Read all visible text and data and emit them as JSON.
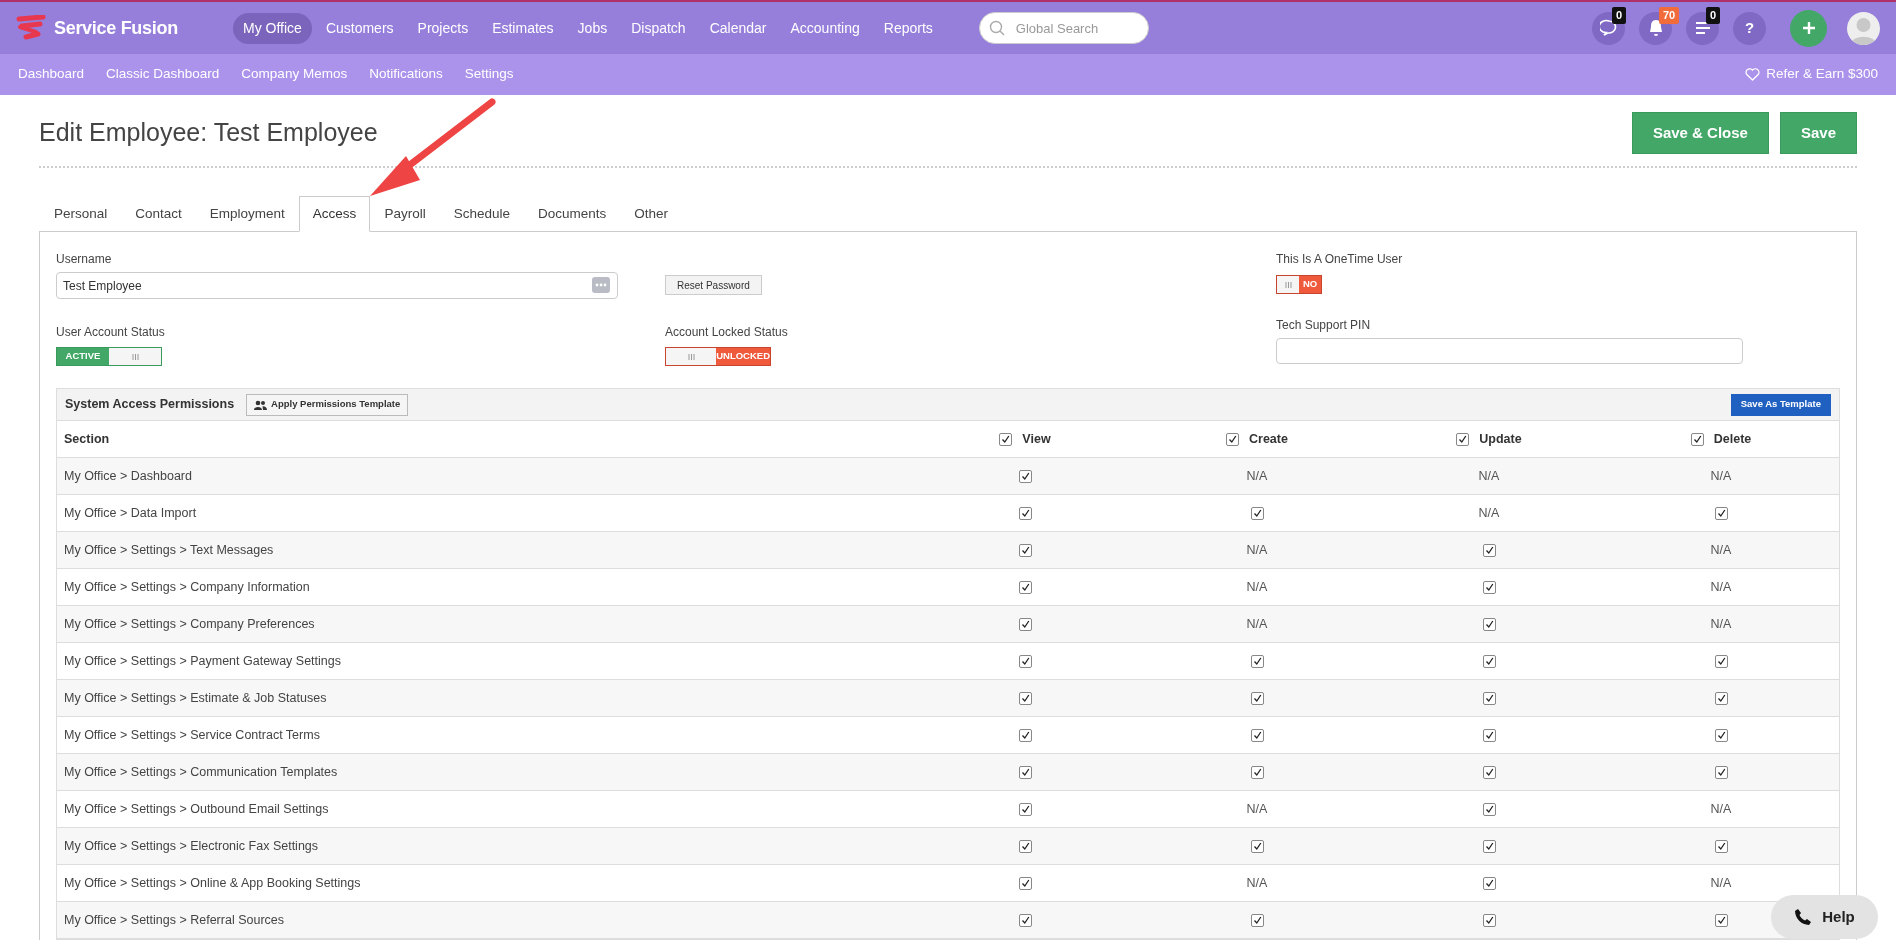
{
  "brand": "Service Fusion",
  "main_nav": [
    {
      "label": "My Office",
      "selected": true
    },
    {
      "label": "Customers",
      "selected": false
    },
    {
      "label": "Projects",
      "selected": false
    },
    {
      "label": "Estimates",
      "selected": false
    },
    {
      "label": "Jobs",
      "selected": false
    },
    {
      "label": "Dispatch",
      "selected": false
    },
    {
      "label": "Calendar",
      "selected": false
    },
    {
      "label": "Accounting",
      "selected": false
    },
    {
      "label": "Reports",
      "selected": false
    }
  ],
  "search": {
    "placeholder": "Global Search"
  },
  "header_icons": [
    {
      "kind": "chat",
      "badge": "0",
      "alert": false
    },
    {
      "kind": "bell",
      "badge": "70",
      "alert": true
    },
    {
      "kind": "list",
      "badge": "0",
      "alert": false
    },
    {
      "kind": "help",
      "text": "?"
    }
  ],
  "sub_nav": [
    "Dashboard",
    "Classic Dashboard",
    "Company Memos",
    "Notifications",
    "Settings"
  ],
  "refer": "Refer & Earn $300",
  "page_title": "Edit Employee: Test Employee",
  "actions": [
    "Save & Close",
    "Save"
  ],
  "tabs": [
    {
      "label": "Personal",
      "selected": false
    },
    {
      "label": "Contact",
      "selected": false
    },
    {
      "label": "Employment",
      "selected": false
    },
    {
      "label": "Access",
      "selected": true
    },
    {
      "label": "Payroll",
      "selected": false
    },
    {
      "label": "Schedule",
      "selected": false
    },
    {
      "label": "Documents",
      "selected": false
    },
    {
      "label": "Other",
      "selected": false
    }
  ],
  "username": {
    "label": "Username",
    "value": "Test Employee"
  },
  "reset_password": "Reset Password",
  "onetime": {
    "label": "This Is A OneTime User",
    "value": "NO",
    "on": false
  },
  "account_status": {
    "label": "User Account Status",
    "value": "ACTIVE",
    "on": true
  },
  "locked_status": {
    "label": "Account Locked Status",
    "value": "UNLOCKED",
    "on": false
  },
  "tech_pin": {
    "label": "Tech Support PIN"
  },
  "permissions": {
    "title": "System Access Permissions",
    "apply_button": "Apply Permissions Template",
    "save_template": "Save As Template",
    "columns": [
      {
        "label": "Section"
      },
      {
        "label": "View",
        "checked": true
      },
      {
        "label": "Create",
        "checked": true
      },
      {
        "label": "Update",
        "checked": true
      },
      {
        "label": "Delete",
        "checked": true
      }
    ],
    "rows": [
      {
        "cells": [
          {
            "kind": "text",
            "text": "My Office > Dashboard"
          },
          {
            "kind": "checkbox",
            "checked": true
          },
          {
            "kind": "text",
            "text": "N/A"
          },
          {
            "kind": "text",
            "text": "N/A"
          },
          {
            "kind": "text",
            "text": "N/A"
          }
        ]
      },
      {
        "cells": [
          {
            "kind": "text",
            "text": "My Office > Data Import"
          },
          {
            "kind": "checkbox",
            "checked": true
          },
          {
            "kind": "checkbox",
            "checked": true
          },
          {
            "kind": "text",
            "text": "N/A"
          },
          {
            "kind": "checkbox",
            "checked": true
          }
        ]
      },
      {
        "cells": [
          {
            "kind": "text",
            "text": "My Office > Settings > Text Messages"
          },
          {
            "kind": "checkbox",
            "checked": true
          },
          {
            "kind": "text",
            "text": "N/A"
          },
          {
            "kind": "checkbox",
            "checked": true
          },
          {
            "kind": "text",
            "text": "N/A"
          }
        ]
      },
      {
        "cells": [
          {
            "kind": "text",
            "text": "My Office > Settings > Company Information"
          },
          {
            "kind": "checkbox",
            "checked": true
          },
          {
            "kind": "text",
            "text": "N/A"
          },
          {
            "kind": "checkbox",
            "checked": true
          },
          {
            "kind": "text",
            "text": "N/A"
          }
        ]
      },
      {
        "cells": [
          {
            "kind": "text",
            "text": "My Office > Settings > Company Preferences"
          },
          {
            "kind": "checkbox",
            "checked": true
          },
          {
            "kind": "text",
            "text": "N/A"
          },
          {
            "kind": "checkbox",
            "checked": true
          },
          {
            "kind": "text",
            "text": "N/A"
          }
        ]
      },
      {
        "cells": [
          {
            "kind": "text",
            "text": "My Office > Settings > Payment Gateway Settings"
          },
          {
            "kind": "checkbox",
            "checked": true
          },
          {
            "kind": "checkbox",
            "checked": true
          },
          {
            "kind": "checkbox",
            "checked": true
          },
          {
            "kind": "checkbox",
            "checked": true
          }
        ]
      },
      {
        "cells": [
          {
            "kind": "text",
            "text": "My Office > Settings > Estimate & Job Statuses"
          },
          {
            "kind": "checkbox",
            "checked": true
          },
          {
            "kind": "checkbox",
            "checked": true
          },
          {
            "kind": "checkbox",
            "checked": true
          },
          {
            "kind": "checkbox",
            "checked": true
          }
        ]
      },
      {
        "cells": [
          {
            "kind": "text",
            "text": "My Office > Settings > Service Contract Terms"
          },
          {
            "kind": "checkbox",
            "checked": true
          },
          {
            "kind": "checkbox",
            "checked": true
          },
          {
            "kind": "checkbox",
            "checked": true
          },
          {
            "kind": "checkbox",
            "checked": true
          }
        ]
      },
      {
        "cells": [
          {
            "kind": "text",
            "text": "My Office > Settings > Communication Templates"
          },
          {
            "kind": "checkbox",
            "checked": true
          },
          {
            "kind": "checkbox",
            "checked": true
          },
          {
            "kind": "checkbox",
            "checked": true
          },
          {
            "kind": "checkbox",
            "checked": true
          }
        ]
      },
      {
        "cells": [
          {
            "kind": "text",
            "text": "My Office > Settings > Outbound Email Settings"
          },
          {
            "kind": "checkbox",
            "checked": true
          },
          {
            "kind": "text",
            "text": "N/A"
          },
          {
            "kind": "checkbox",
            "checked": true
          },
          {
            "kind": "text",
            "text": "N/A"
          }
        ]
      },
      {
        "cells": [
          {
            "kind": "text",
            "text": "My Office > Settings > Electronic Fax Settings"
          },
          {
            "kind": "checkbox",
            "checked": true
          },
          {
            "kind": "checkbox",
            "checked": true
          },
          {
            "kind": "checkbox",
            "checked": true
          },
          {
            "kind": "checkbox",
            "checked": true
          }
        ]
      },
      {
        "cells": [
          {
            "kind": "text",
            "text": "My Office > Settings > Online & App Booking Settings"
          },
          {
            "kind": "checkbox",
            "checked": true
          },
          {
            "kind": "text",
            "text": "N/A"
          },
          {
            "kind": "checkbox",
            "checked": true
          },
          {
            "kind": "text",
            "text": "N/A"
          }
        ]
      },
      {
        "cells": [
          {
            "kind": "text",
            "text": "My Office > Settings > Referral Sources"
          },
          {
            "kind": "checkbox",
            "checked": true
          },
          {
            "kind": "checkbox",
            "checked": true
          },
          {
            "kind": "checkbox",
            "checked": true
          },
          {
            "kind": "checkbox",
            "checked": true
          }
        ]
      }
    ]
  },
  "help_button": "Help"
}
